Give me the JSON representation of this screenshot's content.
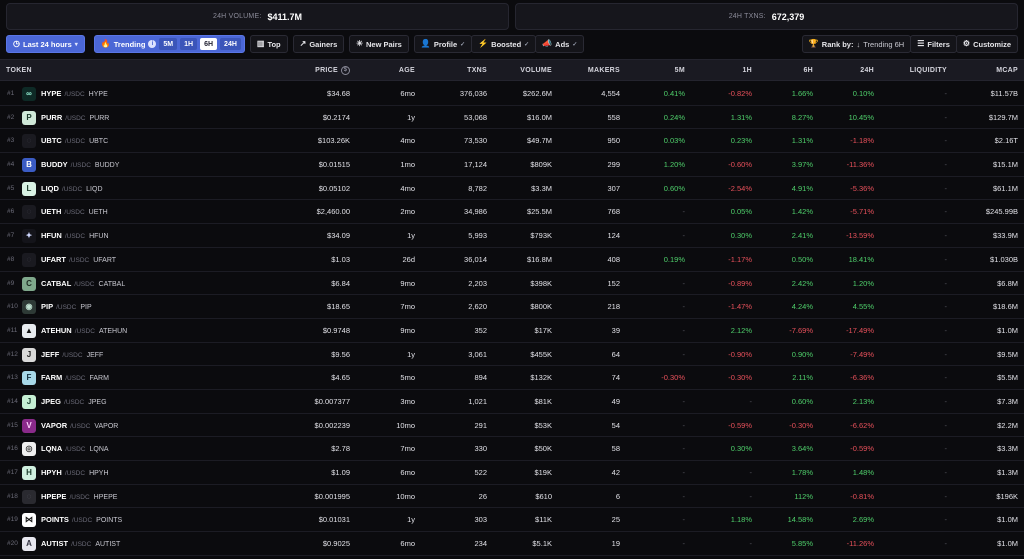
{
  "stats": {
    "volume_label": "24H VOLUME:",
    "volume_value": "$411.7M",
    "txns_label": "24H TXNS:",
    "txns_value": "672,379"
  },
  "toolbar": {
    "time_filter": "Last 24 hours",
    "trending_label": "Trending",
    "timeframes": [
      "5M",
      "1H",
      "6H",
      "24H"
    ],
    "active_timeframe": "6H",
    "top": "Top",
    "gainers": "Gainers",
    "new_pairs": "New Pairs",
    "profile": "Profile",
    "boosted": "Boosted",
    "ads": "Ads",
    "rank_by_label": "Rank by:",
    "rank_by_value": "Trending 6H",
    "filters": "Filters",
    "customize": "Customize"
  },
  "columns": {
    "token": "TOKEN",
    "price": "PRICE",
    "age": "AGE",
    "txns": "TXNS",
    "volume": "VOLUME",
    "makers": "MAKERS",
    "m5": "5M",
    "h1": "1H",
    "h6": "6H",
    "h24": "24H",
    "liquidity": "LIQUIDITY",
    "mcap": "MCAP"
  },
  "colors": {
    "accent": "#4b67d6",
    "positive": "#4fcf6b",
    "negative": "#e8515b"
  },
  "rows": [
    {
      "rank": "#1",
      "symbol": "HYPE",
      "quote": "/USDC",
      "name": "HYPE",
      "price": "$34.68",
      "age": "6mo",
      "txns": "376,036",
      "volume": "$262.6M",
      "makers": "4,554",
      "m5": "0.41%",
      "h1": "-0.82%",
      "h6": "1.66%",
      "h24": "0.10%",
      "liquidity": "-",
      "mcap": "$11.57B",
      "logo_bg": "#0e2a26",
      "logo_fg": "#97f2d6",
      "logo_char": "∞"
    },
    {
      "rank": "#2",
      "symbol": "PURR",
      "quote": "/USDC",
      "name": "PURR",
      "price": "$0.2174",
      "age": "1y",
      "txns": "53,068",
      "volume": "$16.0M",
      "makers": "558",
      "m5": "0.24%",
      "h1": "1.31%",
      "h6": "8.27%",
      "h24": "10.45%",
      "liquidity": "-",
      "mcap": "$129.7M",
      "logo_bg": "#cfe8d8",
      "logo_fg": "#1c3a2c",
      "logo_char": "P"
    },
    {
      "rank": "#3",
      "symbol": "UBTC",
      "quote": "/USDC",
      "name": "UBTC",
      "price": "$103.26K",
      "age": "4mo",
      "txns": "73,530",
      "volume": "$49.7M",
      "makers": "950",
      "m5": "0.03%",
      "h1": "0.23%",
      "h6": "1.31%",
      "h24": "-1.18%",
      "liquidity": "-",
      "mcap": "$2.16T",
      "logo_bg": "#1a1a20",
      "logo_fg": "#44444e",
      "logo_char": "◌"
    },
    {
      "rank": "#4",
      "symbol": "BUDDY",
      "quote": "/USDC",
      "name": "BUDDY",
      "price": "$0.01515",
      "age": "1mo",
      "txns": "17,124",
      "volume": "$809K",
      "makers": "299",
      "m5": "1.20%",
      "h1": "-0.60%",
      "h6": "3.97%",
      "h24": "-11.36%",
      "liquidity": "-",
      "mcap": "$15.1M",
      "logo_bg": "#3b5cc4",
      "logo_fg": "#ffffff",
      "logo_char": "B"
    },
    {
      "rank": "#5",
      "symbol": "LIQD",
      "quote": "/USDC",
      "name": "LIQD",
      "price": "$0.05102",
      "age": "4mo",
      "txns": "8,782",
      "volume": "$3.3M",
      "makers": "307",
      "m5": "0.60%",
      "h1": "-2.54%",
      "h6": "4.91%",
      "h24": "-5.36%",
      "liquidity": "-",
      "mcap": "$61.1M",
      "logo_bg": "#d8f2e4",
      "logo_fg": "#1a3a2a",
      "logo_char": "L"
    },
    {
      "rank": "#6",
      "symbol": "UETH",
      "quote": "/USDC",
      "name": "UETH",
      "price": "$2,460.00",
      "age": "2mo",
      "txns": "34,986",
      "volume": "$25.5M",
      "makers": "768",
      "m5": "-",
      "h1": "0.05%",
      "h6": "1.42%",
      "h24": "-5.71%",
      "liquidity": "-",
      "mcap": "$245.99B",
      "logo_bg": "#1a1a20",
      "logo_fg": "#44444e",
      "logo_char": "◌"
    },
    {
      "rank": "#7",
      "symbol": "HFUN",
      "quote": "/USDC",
      "name": "HFUN",
      "price": "$34.09",
      "age": "1y",
      "txns": "5,993",
      "volume": "$793K",
      "makers": "124",
      "m5": "-",
      "h1": "0.30%",
      "h6": "2.41%",
      "h24": "-13.59%",
      "liquidity": "-",
      "mcap": "$33.9M",
      "logo_bg": "#14141a",
      "logo_fg": "#cfd8ff",
      "logo_char": "✦"
    },
    {
      "rank": "#8",
      "symbol": "UFART",
      "quote": "/USDC",
      "name": "UFART",
      "price": "$1.03",
      "age": "26d",
      "txns": "36,014",
      "volume": "$16.8M",
      "makers": "408",
      "m5": "0.19%",
      "h1": "-1.17%",
      "h6": "0.50%",
      "h24": "18.41%",
      "liquidity": "-",
      "mcap": "$1.030B",
      "logo_bg": "#1a1a20",
      "logo_fg": "#44444e",
      "logo_char": "◌"
    },
    {
      "rank": "#9",
      "symbol": "CATBAL",
      "quote": "/USDC",
      "name": "CATBAL",
      "price": "$6.84",
      "age": "9mo",
      "txns": "2,203",
      "volume": "$398K",
      "makers": "152",
      "m5": "-",
      "h1": "-0.89%",
      "h6": "2.42%",
      "h24": "1.20%",
      "liquidity": "-",
      "mcap": "$6.8M",
      "logo_bg": "#7fa88c",
      "logo_fg": "#1d2a22",
      "logo_char": "C"
    },
    {
      "rank": "#10",
      "symbol": "PIP",
      "quote": "/USDC",
      "name": "PIP",
      "price": "$18.65",
      "age": "7mo",
      "txns": "2,620",
      "volume": "$800K",
      "makers": "218",
      "m5": "-",
      "h1": "-1.47%",
      "h6": "4.24%",
      "h24": "4.55%",
      "liquidity": "-",
      "mcap": "$18.6M",
      "logo_bg": "#2e3a36",
      "logo_fg": "#bfe0d0",
      "logo_char": "◉"
    },
    {
      "rank": "#11",
      "symbol": "ATEHUN",
      "quote": "/USDC",
      "name": "ATEHUN",
      "price": "$0.9748",
      "age": "9mo",
      "txns": "352",
      "volume": "$17K",
      "makers": "39",
      "m5": "-",
      "h1": "2.12%",
      "h6": "-7.69%",
      "h24": "-17.49%",
      "liquidity": "-",
      "mcap": "$1.0M",
      "logo_bg": "#e8ecf0",
      "logo_fg": "#111111",
      "logo_char": "▲"
    },
    {
      "rank": "#12",
      "symbol": "JEFF",
      "quote": "/USDC",
      "name": "JEFF",
      "price": "$9.56",
      "age": "1y",
      "txns": "3,061",
      "volume": "$455K",
      "makers": "64",
      "m5": "-",
      "h1": "-0.90%",
      "h6": "0.90%",
      "h24": "-7.49%",
      "liquidity": "-",
      "mcap": "$9.5M",
      "logo_bg": "#d9d9d9",
      "logo_fg": "#222222",
      "logo_char": "J"
    },
    {
      "rank": "#13",
      "symbol": "FARM",
      "quote": "/USDC",
      "name": "FARM",
      "price": "$4.65",
      "age": "5mo",
      "txns": "894",
      "volume": "$132K",
      "makers": "74",
      "m5": "-0.30%",
      "h1": "-0.30%",
      "h6": "2.11%",
      "h24": "-6.36%",
      "liquidity": "-",
      "mcap": "$5.5M",
      "logo_bg": "#a7d8e8",
      "logo_fg": "#123040",
      "logo_char": "F"
    },
    {
      "rank": "#14",
      "symbol": "JPEG",
      "quote": "/USDC",
      "name": "JPEG",
      "price": "$0.007377",
      "age": "3mo",
      "txns": "1,021",
      "volume": "$81K",
      "makers": "49",
      "m5": "-",
      "h1": "-",
      "h6": "0.60%",
      "h24": "2.13%",
      "liquidity": "-",
      "mcap": "$7.3M",
      "logo_bg": "#c6f0d4",
      "logo_fg": "#1a4030",
      "logo_char": "J"
    },
    {
      "rank": "#15",
      "symbol": "VAPOR",
      "quote": "/USDC",
      "name": "VAPOR",
      "price": "$0.002239",
      "age": "10mo",
      "txns": "291",
      "volume": "$53K",
      "makers": "54",
      "m5": "-",
      "h1": "-0.59%",
      "h6": "-0.30%",
      "h24": "-6.62%",
      "liquidity": "-",
      "mcap": "$2.2M",
      "logo_bg": "#8a2a8a",
      "logo_fg": "#ffd0ff",
      "logo_char": "V"
    },
    {
      "rank": "#16",
      "symbol": "LQNA",
      "quote": "/USDC",
      "name": "LQNA",
      "price": "$2.78",
      "age": "7mo",
      "txns": "330",
      "volume": "$50K",
      "makers": "58",
      "m5": "-",
      "h1": "0.30%",
      "h6": "3.64%",
      "h24": "-0.59%",
      "liquidity": "-",
      "mcap": "$3.3M",
      "logo_bg": "#f0f0f0",
      "logo_fg": "#3a3a3a",
      "logo_char": "◎"
    },
    {
      "rank": "#17",
      "symbol": "HPYH",
      "quote": "/USDC",
      "name": "HPYH",
      "price": "$1.09",
      "age": "6mo",
      "txns": "522",
      "volume": "$19K",
      "makers": "42",
      "m5": "-",
      "h1": "-",
      "h6": "1.78%",
      "h24": "1.48%",
      "liquidity": "-",
      "mcap": "$1.3M",
      "logo_bg": "#d0f0e0",
      "logo_fg": "#1a3a2a",
      "logo_char": "H"
    },
    {
      "rank": "#18",
      "symbol": "HPEPE",
      "quote": "/USDC",
      "name": "HPEPE",
      "price": "$0.001995",
      "age": "10mo",
      "txns": "26",
      "volume": "$610",
      "makers": "6",
      "m5": "-",
      "h1": "-",
      "h6": "112%",
      "h24": "-0.81%",
      "liquidity": "-",
      "mcap": "$196K",
      "logo_bg": "#2a2a30",
      "logo_fg": "#5a5a66",
      "logo_char": "◌"
    },
    {
      "rank": "#19",
      "symbol": "POINTS",
      "quote": "/USDC",
      "name": "POINTS",
      "price": "$0.01031",
      "age": "1y",
      "txns": "303",
      "volume": "$11K",
      "makers": "25",
      "m5": "-",
      "h1": "1.18%",
      "h6": "14.58%",
      "h24": "2.69%",
      "liquidity": "-",
      "mcap": "$1.0M",
      "logo_bg": "#ffffff",
      "logo_fg": "#111111",
      "logo_char": "⋈"
    },
    {
      "rank": "#20",
      "symbol": "AUTIST",
      "quote": "/USDC",
      "name": "AUTIST",
      "price": "$0.9025",
      "age": "6mo",
      "txns": "234",
      "volume": "$5.1K",
      "makers": "19",
      "m5": "-",
      "h1": "-",
      "h6": "5.85%",
      "h24": "-11.26%",
      "liquidity": "-",
      "mcap": "$1.0M",
      "logo_bg": "#e8e8f0",
      "logo_fg": "#333340",
      "logo_char": "A"
    }
  ]
}
